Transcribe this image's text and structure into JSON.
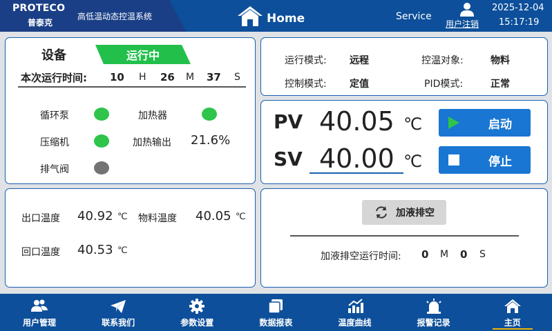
{
  "header": {
    "brand_name": "PROTECO",
    "brand_sub": "普泰克",
    "system_title": "高低温动态控温系统",
    "home_label": "Home",
    "service_label": "Service",
    "logout_label": "用户注销",
    "date": "2025-12-04",
    "time": "15:17:19"
  },
  "device": {
    "title": "设备",
    "status": "运行中",
    "runtime_label": "本次运行时间:",
    "hours": "10",
    "hours_unit": "H",
    "minutes": "26",
    "minutes_unit": "M",
    "seconds": "37",
    "seconds_unit": "S",
    "pump_label": "循环泵",
    "heater_label": "加热器",
    "compressor_label": "压缩机",
    "heat_output_label": "加热输出",
    "heat_output_value": "21.6%",
    "vent_valve_label": "排气阀",
    "pump_on": true,
    "heater_on": true,
    "compressor_on": true,
    "vent_valve_on": false
  },
  "modes": {
    "run_mode_label": "运行模式:",
    "run_mode_value": "远程",
    "control_target_label": "控温对象:",
    "control_target_value": "物料",
    "control_mode_label": "控制模式:",
    "control_mode_value": "定值",
    "pid_mode_label": "PID模式:",
    "pid_mode_value": "正常"
  },
  "process": {
    "pv_label": "PV",
    "pv_value": "40.05",
    "sv_label": "SV",
    "sv_value": "40.00",
    "unit": "℃",
    "start_label": "启动",
    "stop_label": "停止"
  },
  "temps": {
    "outlet_label": "出口温度",
    "outlet_value": "40.92",
    "material_label": "物料温度",
    "material_value": "40.05",
    "return_label": "回口温度",
    "return_value": "40.53",
    "unit": "℃"
  },
  "drain": {
    "button_label": "加液排空",
    "runtime_label": "加液排空运行时间:",
    "minutes": "0",
    "minutes_unit": "M",
    "seconds": "0",
    "seconds_unit": "S"
  },
  "nav": {
    "user_mgmt": "用户管理",
    "contact": "联系我们",
    "params": "参数设置",
    "reports": "数据报表",
    "curves": "温度曲线",
    "alarms": "报警记录",
    "home": "主页"
  },
  "colors": {
    "header_bg": "#0d4f9a",
    "running_green": "#22c04a",
    "off_gray": "#737373",
    "button_blue": "#1976d2"
  }
}
